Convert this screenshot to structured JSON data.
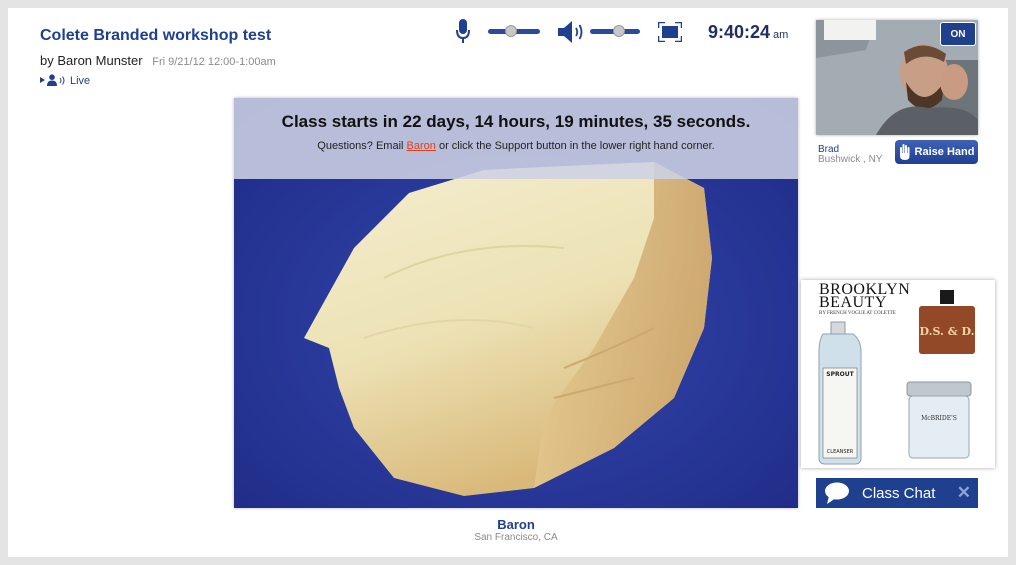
{
  "header": {
    "title": "Colete Branded workshop test",
    "by_label": "by Baron Munster",
    "date": "Fri 9/21/12   12:00-1:00am",
    "live_label": "Live"
  },
  "controls": {
    "mic_icon": "microphone-icon",
    "speaker_icon": "speaker-icon",
    "fullscreen_icon": "fullscreen-icon",
    "mic_level": 0.45,
    "volume_level": 0.58,
    "clock_time": "9:40:24",
    "clock_ampm": "am"
  },
  "stage": {
    "countdown": "Class starts in 22 days, 14 hours, 19 minutes, 35 seconds.",
    "questions_prefix": "Questions? Email ",
    "questions_link": "Baron",
    "questions_suffix": " or click the Support button in the lower right hand corner.",
    "presenter_name": "Baron",
    "presenter_location": "San Francisco, CA"
  },
  "webcam": {
    "on_label": "ON",
    "viewer_name": "Brad",
    "viewer_location": "Bushwick , NY",
    "raise_hand_label": "Raise Hand"
  },
  "ad": {
    "title_line1": "BROOKLYN",
    "title_line2": "BEAUTY",
    "subtitle": "BY FRENCH VOGUE AT COLETTE",
    "product_labels": [
      "SPROUT",
      "CLEANSER",
      "D.S. & D.",
      "McBRIDE'S"
    ]
  },
  "chat": {
    "label": "Class Chat",
    "close": "✕"
  },
  "colors": {
    "brand_blue": "#1f3f8f",
    "link_orange": "#e0401c",
    "stage_blue": "#2a3a9e"
  }
}
